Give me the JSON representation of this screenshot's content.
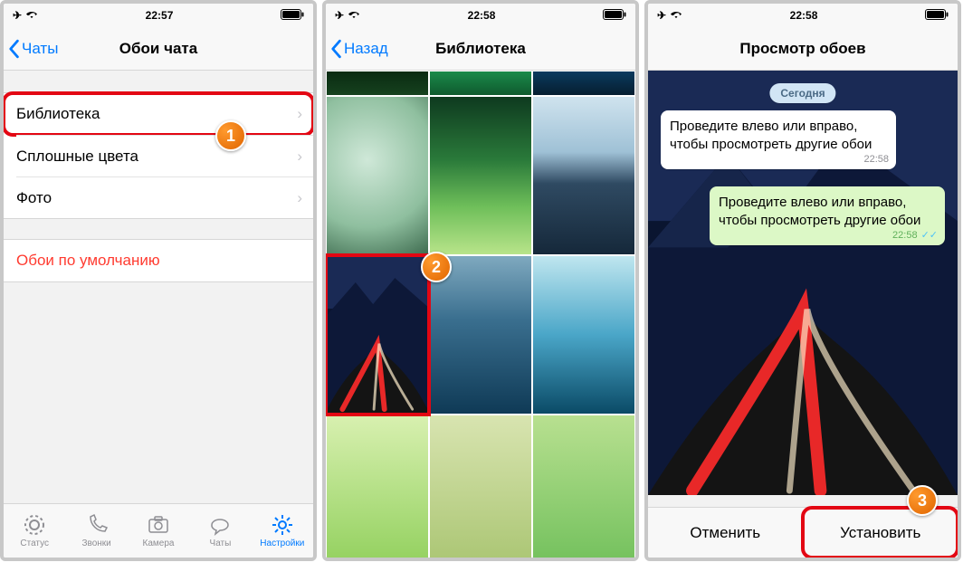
{
  "screen1": {
    "status_time": "22:57",
    "back_label": "Чаты",
    "title": "Обои чата",
    "rows": {
      "library": "Библиотека",
      "solid": "Сплошные цвета",
      "photo": "Фото",
      "default": "Обои по умолчанию"
    },
    "tabs": {
      "status": "Статус",
      "calls": "Звонки",
      "camera": "Камера",
      "chats": "Чаты",
      "settings": "Настройки"
    },
    "callout": "1"
  },
  "screen2": {
    "status_time": "22:58",
    "back_label": "Назад",
    "title": "Библиотека",
    "callout": "2"
  },
  "screen3": {
    "status_time": "22:58",
    "title": "Просмотр обоев",
    "date_pill": "Сегодня",
    "msg_in": "Проведите влево или вправо, чтобы просмотреть другие обои",
    "msg_in_time": "22:58",
    "msg_out": "Проведите влево или вправо, чтобы просмотреть другие обои",
    "msg_out_time": "22:58",
    "cancel": "Отменить",
    "set": "Установить",
    "callout": "3"
  }
}
